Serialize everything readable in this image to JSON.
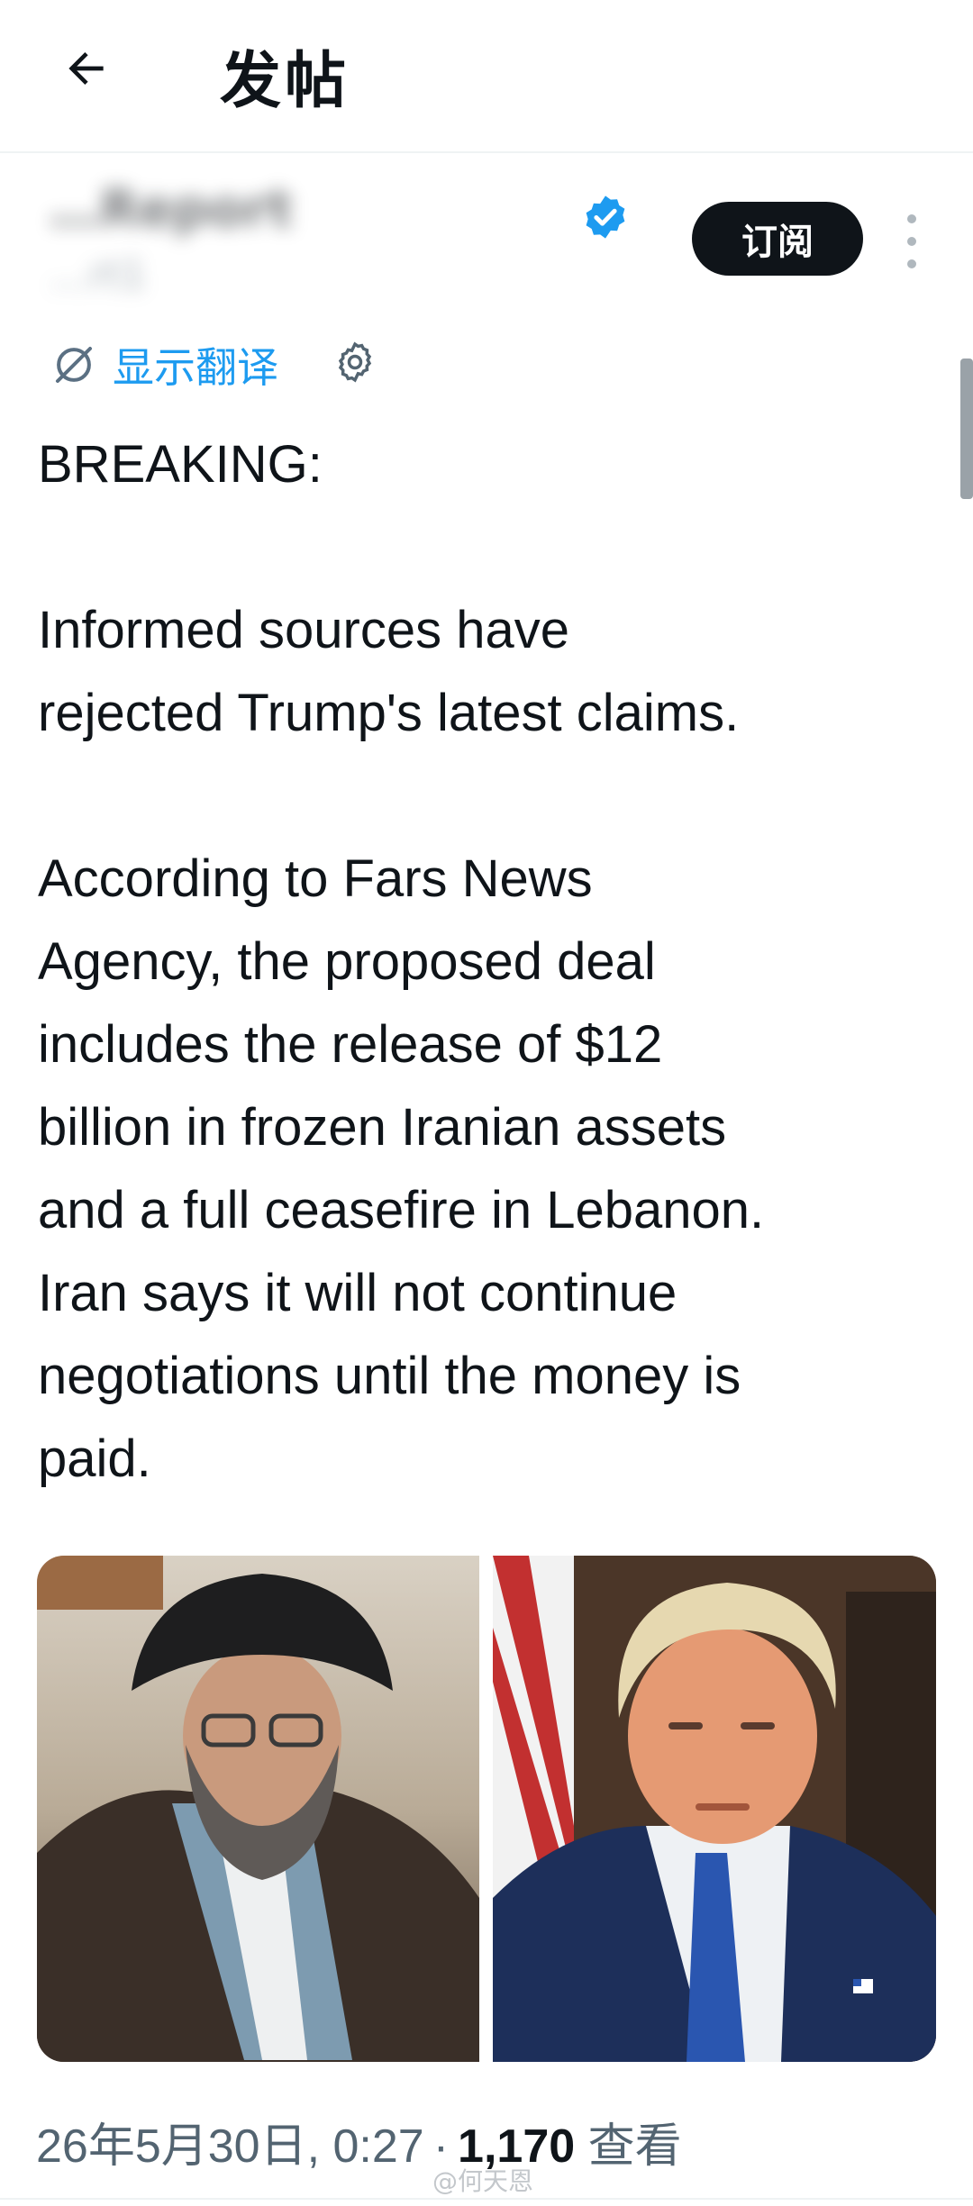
{
  "header": {
    "title": "发帖"
  },
  "author": {
    "name": "…Report",
    "handle": "…rt1"
  },
  "subscribe_label": "订阅",
  "translate_label": "显示翻译",
  "tweet_text": "BREAKING:\n\nInformed sources have\nrejected Trump's latest claims.\n\nAccording to Fars News\nAgency, the proposed deal\nincludes the release of $12\nbillion in frozen Iranian assets\nand a full ceasefire in Lebanon.\nIran says it will not continue\nnegotiations until the money is\npaid.",
  "meta": {
    "timestamp": "26年5月30日, 0:27",
    "separator": "·",
    "views": "1,170",
    "views_label": " 查看"
  },
  "watermark": "@何天恩",
  "colors": {
    "accent": "#1d9bf0",
    "text": "#0f1419",
    "muted": "#536471"
  }
}
